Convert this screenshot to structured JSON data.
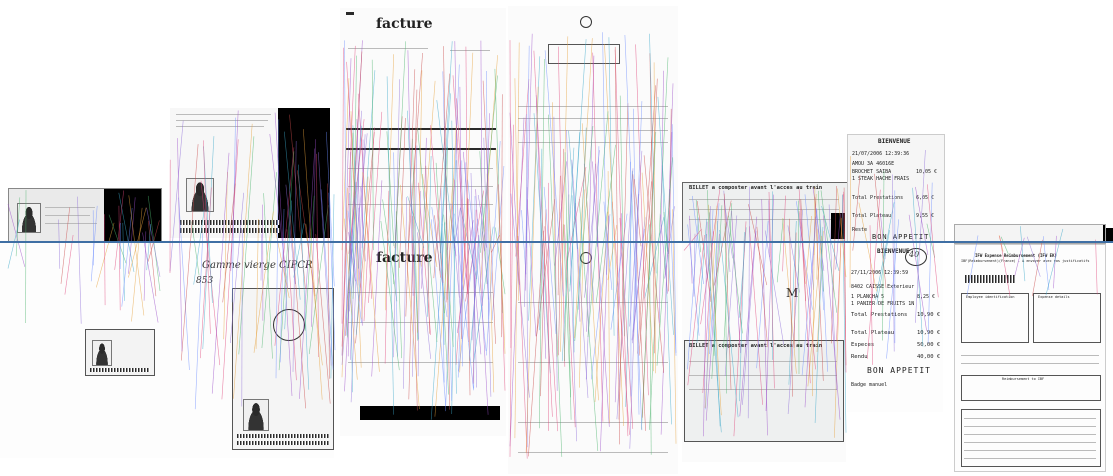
{
  "image": {
    "kind": "document keypoint-matching visualization",
    "divider_color": "#3f6fa4",
    "match_palette": [
      "#9b4dca",
      "#e0457b",
      "#3aa8c9",
      "#6c8cff",
      "#e6a23c",
      "#49b36b",
      "#c94a4a",
      "#8e6bd8"
    ]
  },
  "texts": {
    "facture_top": "facture",
    "facture_bottom": "facture",
    "receipt_header_top": "BIENVENUE",
    "receipt_header_bottom": "BIENVENUE",
    "bon_appetit_top": "BON APPETIT",
    "bon_appetit_bottom": "BON APPETIT",
    "train_notice_top": "BILLET a composter avant l'acces au train",
    "train_notice_bottom": "BILLET a composter avant l'acces au train",
    "receipt_lines_top": [
      "21/07/2006  12:39:36",
      "NEW# 1 DAY",
      "AMOU 3A 46016E",
      "Badge : 611729",
      "BROCHET SAIBA",
      "1 STEAK HACHE FRAIS",
      "1 DESSERT RAP 1",
      "Total Prestations",
      "Total Plateau",
      "Reste"
    ],
    "receipt_lines_bottom": [
      "27/11/2006  12:39:59",
      "BadgeP 1 202",
      "8402 CAISSE Exterieur",
      "Badge : 1",
      "1 PLANCHA 5",
      "1 PANIER DE FRUITS  1N",
      "Total Prestations",
      "Total Plateau",
      "Especes",
      "Rendu",
      "Badge manuel"
    ],
    "receipt_amounts_top": [
      "10,05 €",
      "0,57 €",
      "1,74 €",
      "6,05 €",
      "9,55 €",
      "11,11 €"
    ],
    "receipt_amounts_bottom": [
      "8,25 €",
      "1,37 €",
      "10,90 €",
      "10,90 €",
      "50,00 €",
      "40,00 €"
    ],
    "handwritten_circle_top": "40",
    "handwritten_circle_bottom": "40",
    "ticket_mark": "M",
    "handwritten_note": "Gamme vierge CIPCR",
    "handwritten_ref": "853",
    "euro_doc_title": "IFW Expense Reimbursement (IFW EK)",
    "euro_doc_subtitle": "IBF(Reimbursement)(France) - A envoyer avec vos justificatifs",
    "euro_doc_section_a": "Employee identification",
    "euro_doc_section_b": "Expense details",
    "euro_doc_footer": "Reimbursement to IBF"
  }
}
